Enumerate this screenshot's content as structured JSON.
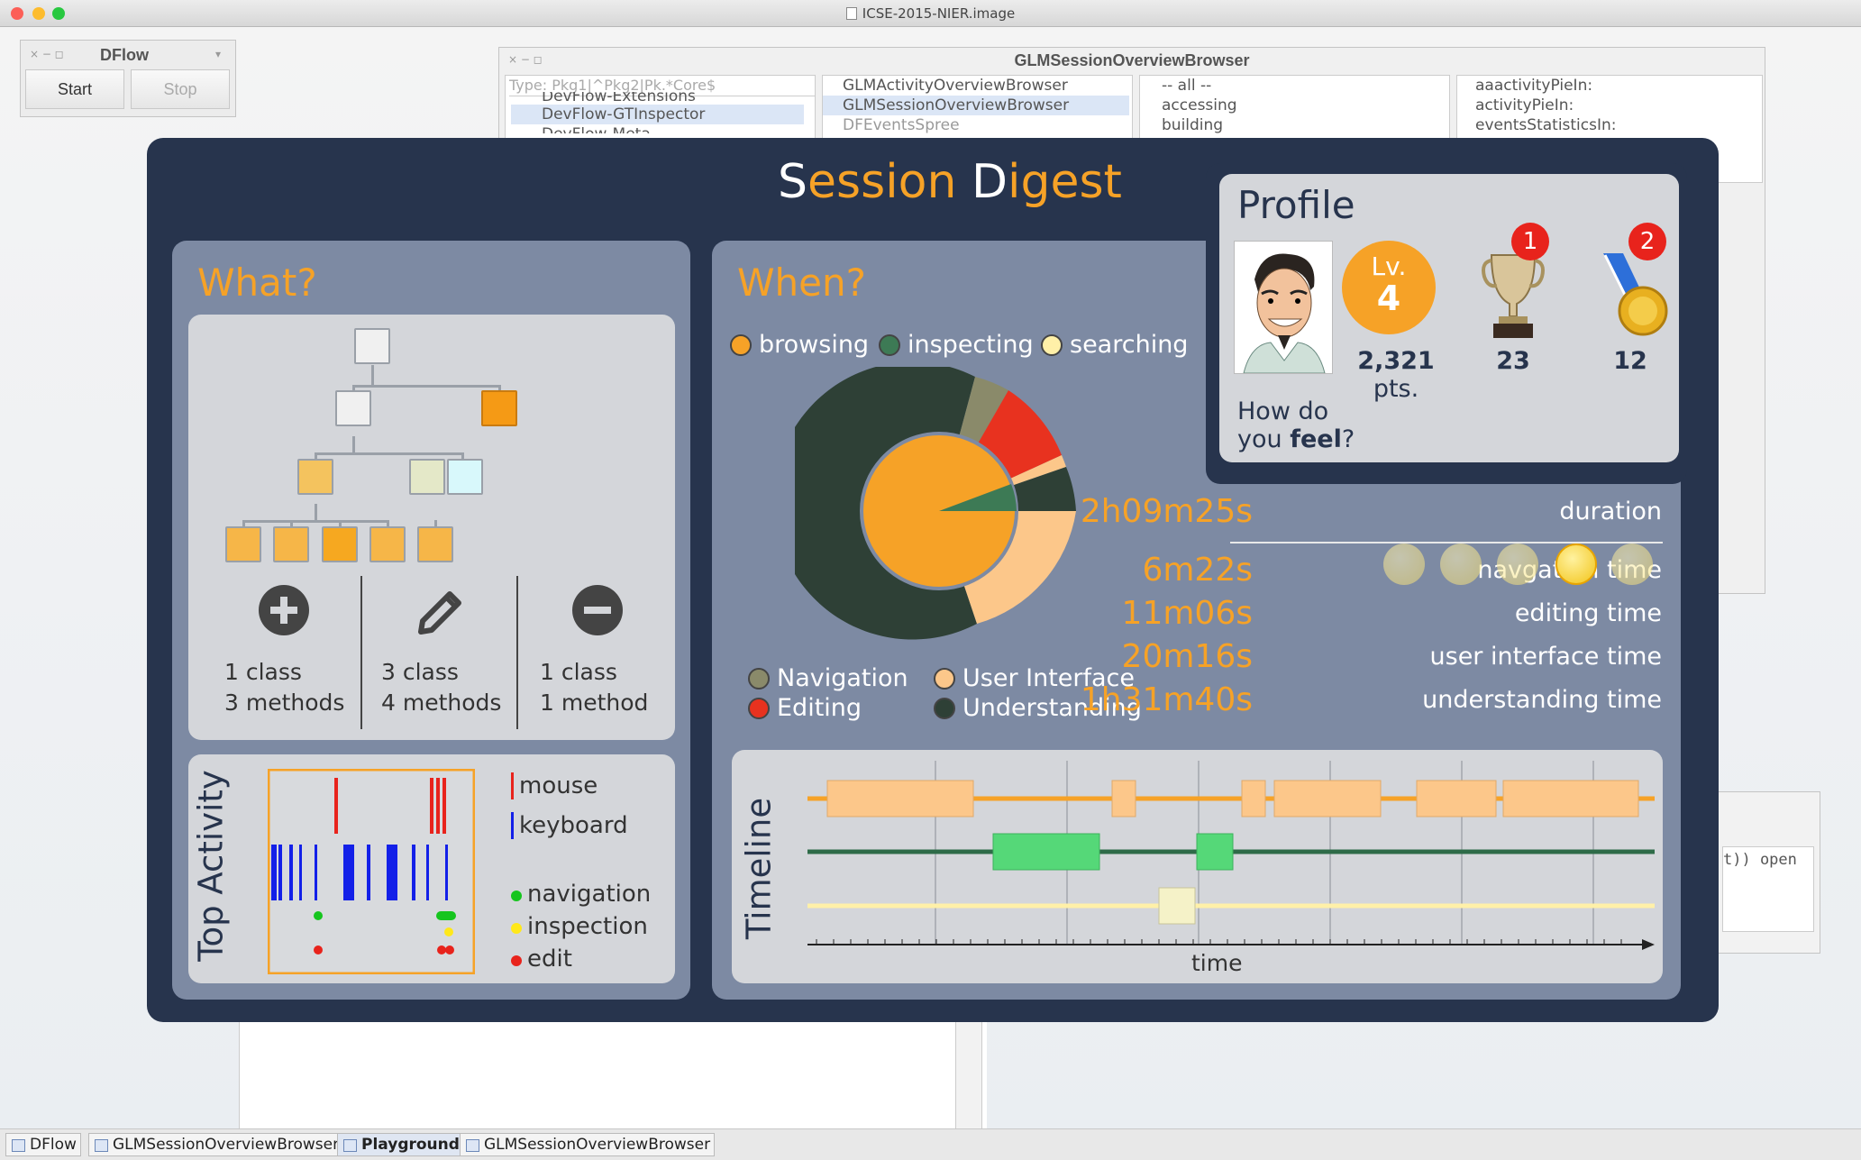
{
  "window": {
    "title": "ICSE-2015-NIER.image"
  },
  "dflow": {
    "title": "DFlow",
    "start_label": "Start",
    "stop_label": "Stop"
  },
  "browser": {
    "title": "GLMSessionOverviewBrowser",
    "filter_placeholder": "Type: Pkg1|^Pkg2|Pk.*Core$",
    "packages": [
      "DevFlow-Extensions",
      "DevFlow-GTInspector",
      "DevFlow-Meta"
    ],
    "classes": [
      "GLMActivityOverviewBrowser",
      "GLMSessionOverviewBrowser",
      "DFEventsSpree"
    ],
    "protocols": [
      "-- all --",
      "accessing",
      "building"
    ],
    "methods": [
      "aaactivityPieIn:",
      "activityPieIn:",
      "eventsStatisticsIn:"
    ]
  },
  "digest": {
    "title_s": "S",
    "title_ession": "ession ",
    "title_d": "D",
    "title_igest": "igest"
  },
  "what": {
    "heading": "What?",
    "added": {
      "l1": "1 class",
      "l2": "3 methods"
    },
    "modified": {
      "l1": "3 class",
      "l2": "4 methods"
    },
    "removed": {
      "l1": "1 class",
      "l2": "1 method"
    }
  },
  "when": {
    "heading": "When?",
    "legend_top": [
      "browsing",
      "inspecting",
      "searching"
    ],
    "legend_bottom": [
      "Navigation",
      "User Interface",
      "Editing",
      "Understanding"
    ],
    "colors": {
      "browsing": "#f6a227",
      "inspecting": "#3d7a55",
      "searching": "#fff0a8",
      "navigation": "#8a8a6a",
      "ui": "#fcc78a",
      "editing": "#e8321f",
      "understanding": "#2e4036"
    }
  },
  "profile": {
    "heading": "Profile",
    "level_prefix": "Lv.",
    "level": "4",
    "points": "2,321",
    "points_unit": " pts.",
    "trophies": "23",
    "medals": "12",
    "trophy_badge": "1",
    "medal_badge": "2",
    "feel_l1": "How do",
    "feel_l2a": "you ",
    "feel_l2b": "feel",
    "feel_l2c": "?",
    "feel_selected": 4
  },
  "metrics": [
    {
      "value": "2h09m25s",
      "label": "duration"
    },
    {
      "value": "6m22s",
      "label": "navgation time"
    },
    {
      "value": "11m06s",
      "label": "editing time"
    },
    {
      "value": "20m16s",
      "label": "user interface time"
    },
    {
      "value": "1h31m40s",
      "label": "understanding time"
    }
  ],
  "top_activity": {
    "heading": "Top Activity",
    "legend": [
      "mouse",
      "keyboard",
      "navigation",
      "inspection",
      "edit"
    ]
  },
  "timeline": {
    "heading": "Timeline",
    "axis_label": "time"
  },
  "code_fragment": "t)) open",
  "taskbar": [
    "DFlow",
    "GLMSessionOverviewBrowser",
    "Playground",
    "GLMSessionOverviewBrowser"
  ]
}
